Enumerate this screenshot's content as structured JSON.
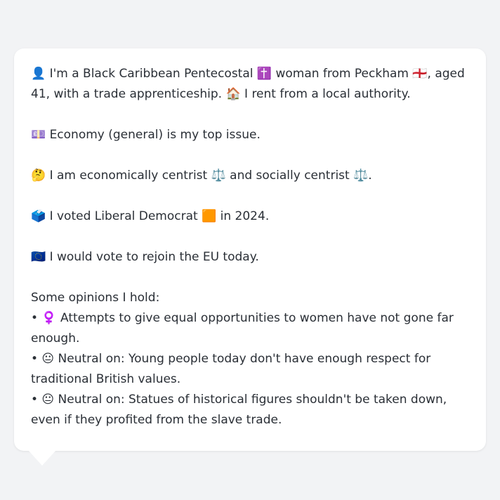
{
  "persona": {
    "intro_part1": "👤 I'm a Black Caribbean Pentecostal ✝️ woman from Peckham 🏴󠁧󠁢󠁥󠁮󠁧󠁿, aged 41, with a trade apprenticeship. 🏠 I rent from a local authority.",
    "top_issue": "💷 Economy (general) is my top issue.",
    "ideology": "🤔 I am economically centrist ⚖️ and socially centrist ⚖️.",
    "vote_2024": "🗳️ I voted Liberal Democrat 🟧 in 2024.",
    "eu_stance": "🇪🇺 I would vote to rejoin the EU today.",
    "opinions_heading": "Some opinions I hold:",
    "opinions": [
      "• ♀️ Attempts to give equal opportunities to women have not gone far enough.",
      "• 😐 Neutral on: Young people today don't have enough respect for traditional British values.",
      "• 😐 Neutral on: Statues of historical figures shouldn't be taken down, even if they profited from the slave trade."
    ]
  }
}
